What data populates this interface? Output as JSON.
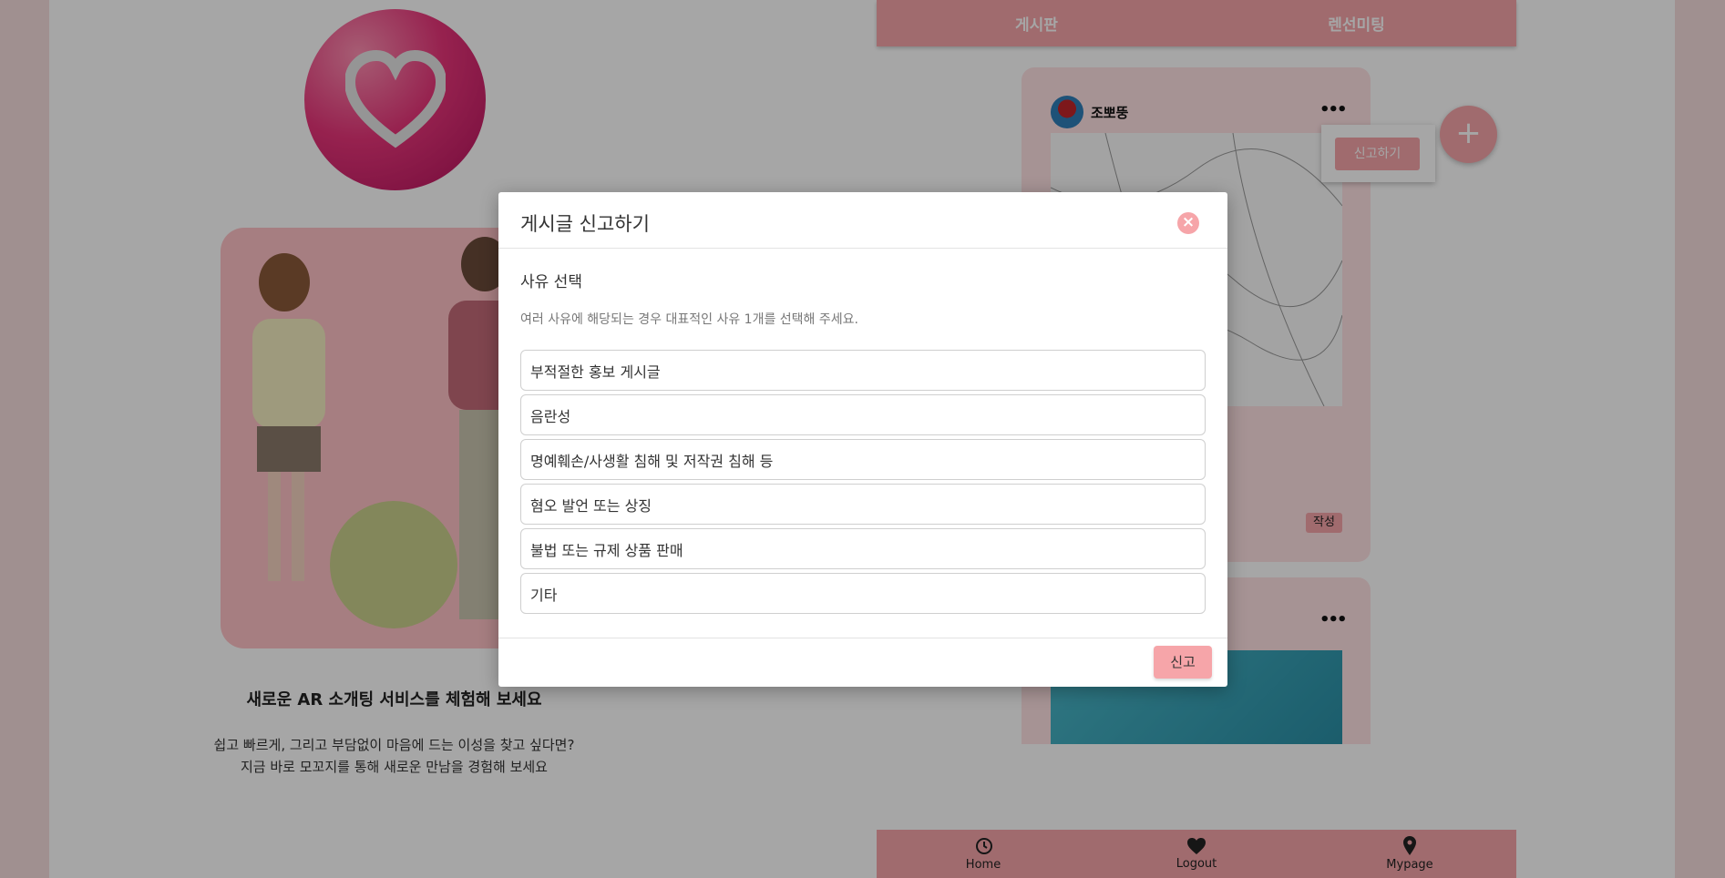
{
  "header": {
    "tabs": [
      {
        "label": "게시판"
      },
      {
        "label": "렌선미팅"
      }
    ]
  },
  "hero": {
    "title": "새로운 AR 소개팅 서비스를 체험해 보세요",
    "line1": "쉽고 빠르게, 그리고 부담없이 마음에 드는 이성을 찾고 싶다면?",
    "line2": "지금 바로 모꼬지를 통해 새로운 만남을 경험해 보세요"
  },
  "post": {
    "author": "조뽀뚱",
    "menu_icon": "•••",
    "write_label": "작성",
    "report_popup_label": "신고하기"
  },
  "fab": {
    "label": "+"
  },
  "bottom_nav": [
    {
      "label": "Home",
      "icon": "history-icon"
    },
    {
      "label": "Logout",
      "icon": "heart-icon"
    },
    {
      "label": "Mypage",
      "icon": "map-pin-icon"
    }
  ],
  "modal": {
    "title": "게시글 신고하기",
    "close_icon": "×",
    "section_title": "사유 선택",
    "hint": "여러 사유에 해당되는 경우 대표적인 사유 1개를 선택해 주세요.",
    "reasons": [
      "부적절한 홍보 게시글",
      "음란성",
      "명예훼손/사생활 침해 및 저작권 침해 등",
      "혐오 발언 또는 상징",
      "불법 또는 규제 상품 판매",
      "기타"
    ],
    "submit_label": "신고"
  },
  "colors": {
    "accent": "#f6a5a9",
    "background": "#f6dede",
    "overlay": "rgba(0,0,0,0.35)"
  }
}
